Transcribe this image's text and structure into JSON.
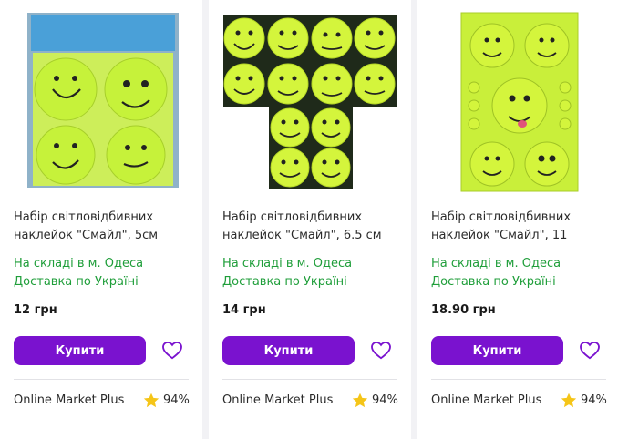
{
  "products": [
    {
      "title": "Набір світловідбивних наклейок \"Смайл\", 5см",
      "stock": "На складі в м. Одеса",
      "delivery": "Доставка по Україні",
      "price": "12 грн",
      "buy_label": "Купити",
      "seller": "Online Market Plus",
      "rating": "94%"
    },
    {
      "title": "Набір світловідбивних наклейок \"Смайл\", 6.5 см",
      "stock": "На складі в м. Одеса",
      "delivery": "Доставка по Україні",
      "price": "14 грн",
      "buy_label": "Купити",
      "seller": "Online Market Plus",
      "rating": "94%"
    },
    {
      "title": "Набір світловідбивних наклейок \"Смайл\", 11",
      "stock": "На складі в м. Одеса",
      "delivery": "Доставка по Україні",
      "price": "18.90 грн",
      "buy_label": "Купити",
      "seller": "Online Market Plus",
      "rating": "94%"
    }
  ],
  "colors": {
    "accent": "#7a12cf",
    "stock_green": "#1f9e3a",
    "star": "#f5c518",
    "sticker": "#c6f23a"
  },
  "icons": {
    "favorite": "heart-outline-icon",
    "rating": "star-icon"
  }
}
